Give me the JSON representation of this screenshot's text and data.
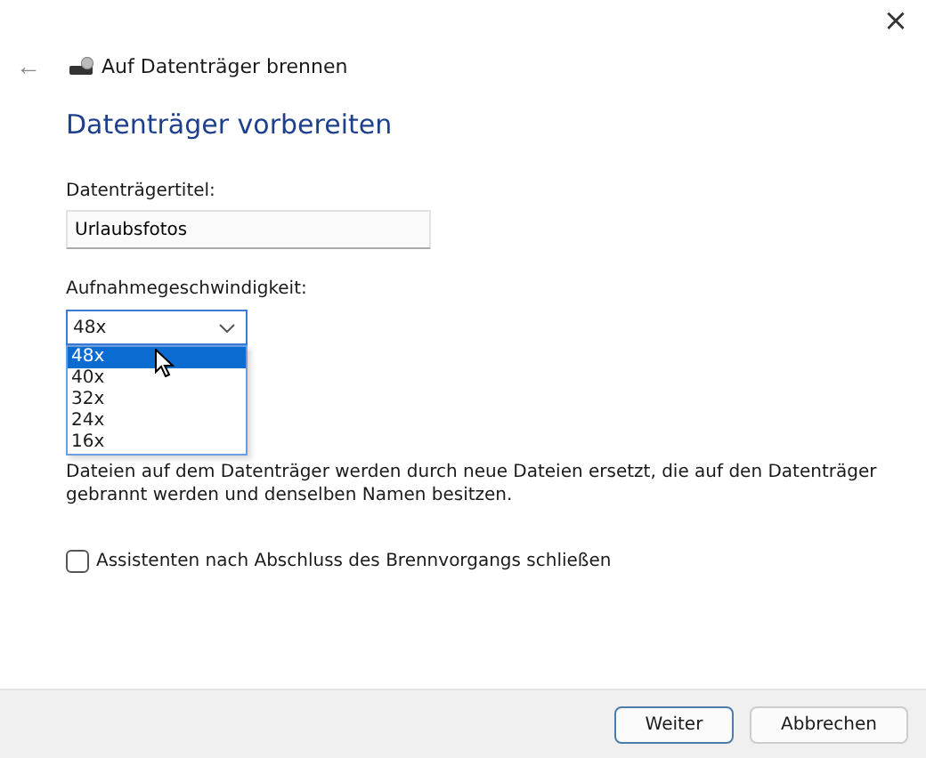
{
  "window": {
    "title": "Auf Datenträger brennen",
    "close": "×",
    "back": "←"
  },
  "heading": "Datenträger vorbereiten",
  "title_field": {
    "label": "Datenträgertitel:",
    "value": "Urlaubsfotos"
  },
  "speed": {
    "label": "Aufnahmegeschwindigkeit:",
    "value": "48x",
    "expanded": true,
    "options": [
      {
        "label": "48x",
        "selected": true
      },
      {
        "label": "40x",
        "selected": false
      },
      {
        "label": "32x",
        "selected": false
      },
      {
        "label": "24x",
        "selected": false
      },
      {
        "label": "16x",
        "selected": false
      }
    ]
  },
  "note": "Dateien auf dem Datenträger werden durch neue Dateien ersetzt, die auf den Datenträger gebrannt werden und denselben Namen besitzen.",
  "close_wizard": {
    "label": "Assistenten nach Abschluss des Brennvorgangs schließen",
    "checked": false
  },
  "buttons": [
    {
      "label": "Weiter",
      "default": true
    },
    {
      "label": "Abbrechen",
      "default": false
    }
  ]
}
